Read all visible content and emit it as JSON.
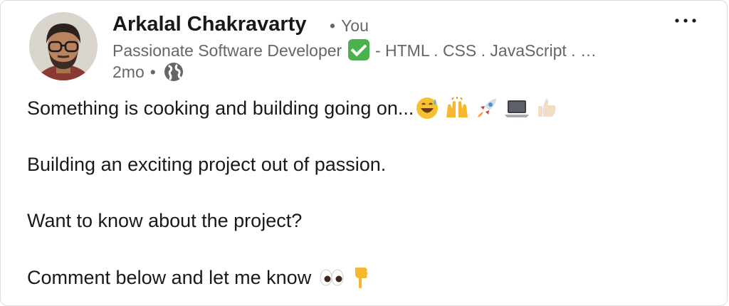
{
  "author": {
    "name": "Arkalal Chakravarty",
    "relation_separator": "•",
    "relation": "You",
    "headline_pre": "Passionate Software Developer",
    "headline_post": "- HTML . CSS . JavaScript . …",
    "timestamp": "2mo",
    "meta_separator": "•"
  },
  "post": {
    "line1": "Something is cooking and building going on...",
    "line2": "Building an exciting project out of passion.",
    "line3": "Want to know about the project?",
    "line4": "Comment below and let me know"
  },
  "icons": {
    "more": "ellipsis-icon",
    "visibility": "globe-icon",
    "verified": "check-mark-icon"
  },
  "colors": {
    "name": "#191919",
    "secondary": "#666666",
    "check_green": "#4cb050",
    "card_border": "#dcdcdc"
  }
}
